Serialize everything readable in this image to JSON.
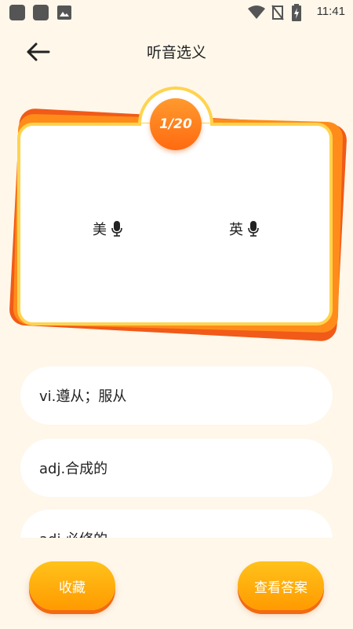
{
  "status_bar": {
    "time": "11:41"
  },
  "header": {
    "title": "听音选义"
  },
  "card": {
    "progress": "1/20",
    "pronunciations": [
      {
        "label": "美"
      },
      {
        "label": "英"
      }
    ]
  },
  "options": [
    {
      "text": "vi.遵从；服从"
    },
    {
      "text": "adj.合成的"
    },
    {
      "text": "adj.必修的"
    }
  ],
  "buttons": {
    "favorite": "收藏",
    "view_answer": "查看答案"
  },
  "colors": {
    "background": "#FEF7EA",
    "accent_orange": "#FF7A14",
    "card_border": "#FFD34E",
    "button_yellow": "#FFB20F"
  }
}
